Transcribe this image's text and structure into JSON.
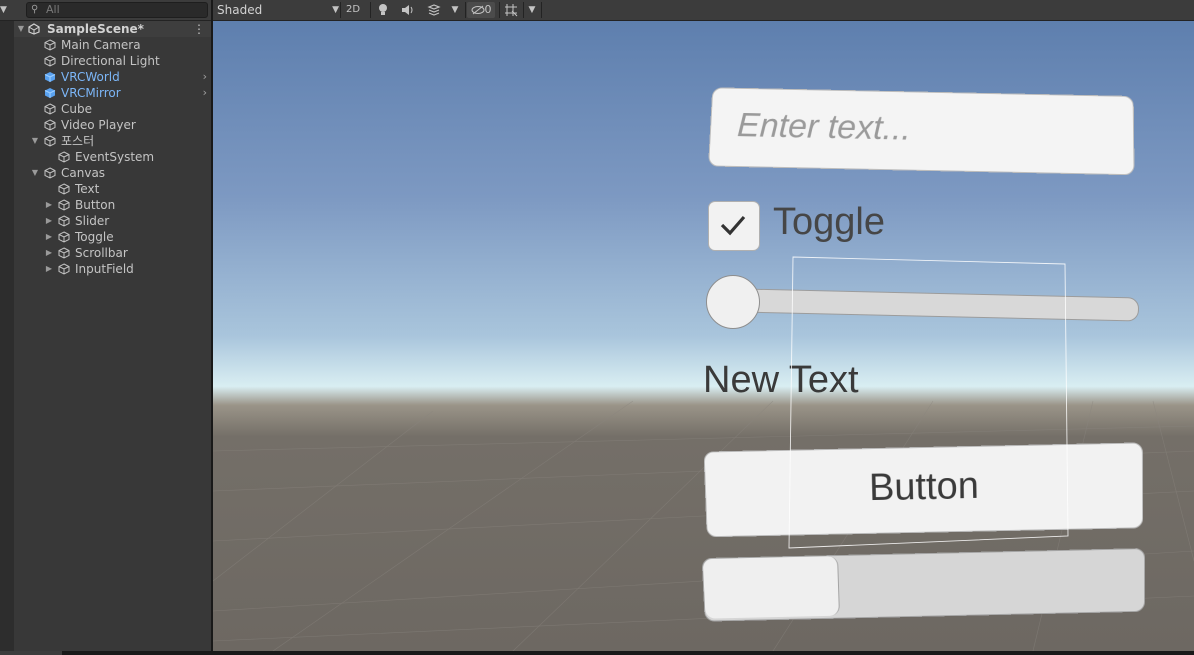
{
  "hierarchy": {
    "search_placeholder": "All",
    "scene_name": "SampleScene*",
    "items": [
      {
        "label": "Main Camera",
        "icon": "cube-icon"
      },
      {
        "label": "Directional Light",
        "icon": "cube-icon"
      },
      {
        "label": "VRCWorld",
        "icon": "prefab-cube-icon",
        "prefab": true,
        "has_children": true
      },
      {
        "label": "VRCMirror",
        "icon": "prefab-cube-icon",
        "prefab": true,
        "has_children": true
      },
      {
        "label": "Cube",
        "icon": "cube-icon"
      },
      {
        "label": "Video Player",
        "icon": "cube-icon"
      },
      {
        "label": "포스터",
        "icon": "cube-icon",
        "expanded": true
      },
      {
        "label": "EventSystem",
        "icon": "cube-icon"
      },
      {
        "label": "Canvas",
        "icon": "cube-icon",
        "expanded": true
      },
      {
        "label": "Text",
        "icon": "cube-icon"
      },
      {
        "label": "Button",
        "icon": "cube-icon",
        "collapsed": true
      },
      {
        "label": "Slider",
        "icon": "cube-icon",
        "collapsed": true
      },
      {
        "label": "Toggle",
        "icon": "cube-icon",
        "collapsed": true
      },
      {
        "label": "Scrollbar",
        "icon": "cube-icon",
        "collapsed": true
      },
      {
        "label": "InputField",
        "icon": "cube-icon",
        "collapsed": true
      }
    ]
  },
  "scene_toolbar": {
    "shading_mode": "Shaded",
    "mode_2d": "2D",
    "hidden_count": "0",
    "icons": [
      "lightbulb-icon",
      "audio-icon",
      "effects-icon",
      "hidden-objects-icon",
      "gizmos-icon"
    ]
  },
  "scene_view": {
    "input_placeholder": "Enter text...",
    "toggle_label": "Toggle",
    "toggle_checked": true,
    "slider_value": 0,
    "text_label": "New Text",
    "button_label": "Button",
    "scrollbar_value": 0
  },
  "colors": {
    "panel_bg": "#383838",
    "toolbar_bg": "#3c3c3c",
    "prefab_blue": "#7cb6f7",
    "sky_top": "#5e7fae",
    "ground": "#6d6862"
  }
}
